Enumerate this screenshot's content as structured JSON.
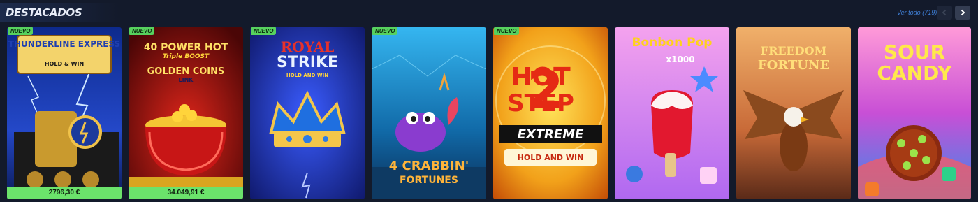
{
  "section": {
    "title": "DESTACADOS",
    "view_all_label": "Ver todo (719)"
  },
  "nav": {
    "prev_icon": "chevron-left-icon",
    "next_icon": "chevron-right-icon"
  },
  "games": [
    {
      "name": "THUNDERLINE EXPRESS",
      "subtitle": "HOLD & WIN",
      "badge": "NUEVO",
      "jackpot": "2796,30 €"
    },
    {
      "name": "40 POWER HOT",
      "line2": "Triple",
      "line3": "BOOST",
      "line4": "GOLDEN COINS",
      "line5": "LINK",
      "badge": "NUEVO",
      "jackpot": "34.049,91 €"
    },
    {
      "name": "ROYAL",
      "line2": "STRIKE",
      "subtitle": "HOLD AND WIN",
      "badge": "NUEVO"
    },
    {
      "name": "4 CRABBIN'",
      "line2": "FORTUNES",
      "badge": "NUEVO"
    },
    {
      "name": "HOT",
      "line2": "STEP",
      "line3": "2",
      "line4": "EXTREME",
      "subtitle": "HOLD AND WIN",
      "badge": "NUEVO"
    },
    {
      "name": "Bonbon Pop",
      "line2": "x1000"
    },
    {
      "name": "FREEDOM",
      "line2": "FORTUNE"
    },
    {
      "name": "SOUR",
      "line2": "CANDY"
    }
  ],
  "colors": {
    "background": "#131a2b",
    "badge": "#57d15e",
    "jackpot_bar": "#6be36b",
    "link": "#3f7fd6"
  }
}
